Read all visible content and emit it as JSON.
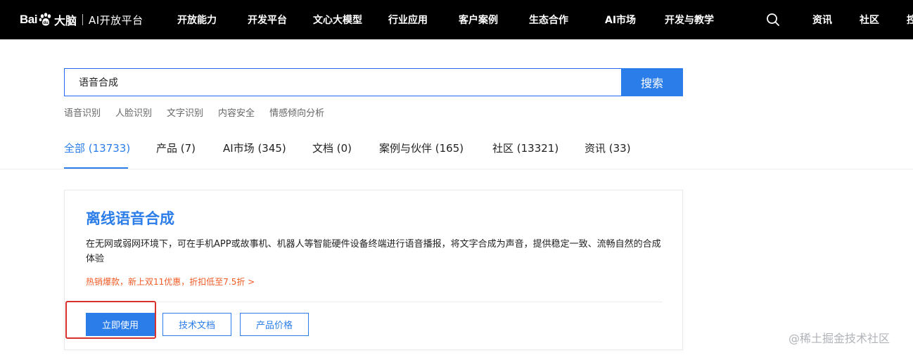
{
  "topnav": {
    "logo": {
      "bai": "Bai",
      "du": "大脑",
      "sub": "AI开放平台"
    },
    "items": [
      {
        "label": "开放能力"
      },
      {
        "label": "开发平台"
      },
      {
        "label": "文心大模型"
      },
      {
        "label": "行业应用"
      },
      {
        "label": "客户案例"
      },
      {
        "label": "生态合作"
      },
      {
        "label": "AI市场"
      },
      {
        "label": "开发与教学"
      }
    ],
    "search_icon": "search-icon",
    "right_items": [
      {
        "label": "资讯"
      },
      {
        "label": "社区"
      },
      {
        "label": "控"
      }
    ]
  },
  "search": {
    "value": "语音合成",
    "button_label": "搜索",
    "hot_keywords": [
      "语音识别",
      "人脸识别",
      "文字识别",
      "内容安全",
      "情感倾向分析"
    ]
  },
  "tabs": [
    {
      "label": "全部 (13733)",
      "active": true
    },
    {
      "label": "产品 (7)"
    },
    {
      "label": "AI市场 (345)"
    },
    {
      "label": "文档 (0)"
    },
    {
      "label": "案例与伙伴 (165)"
    },
    {
      "label": "社区 (13321)"
    },
    {
      "label": "资讯 (33)"
    }
  ],
  "result": {
    "title": "离线语音合成",
    "description": "在无网或弱网环境下，可在手机APP或故事机、机器人等智能硬件设备终端进行语音播报，将文字合成为声音，提供稳定一致、流畅自然的合成体验",
    "promo": "热销爆款，新上双11优惠，折扣低至7.5折 >",
    "buttons": {
      "use": "立即使用",
      "doc": "技术文档",
      "price": "产品价格"
    }
  },
  "watermark": "@稀土掘金技术社区",
  "colors": {
    "accent": "#2b7de9",
    "promo": "#f05a24",
    "highlight": "#d9302c",
    "nav_bg": "#000000"
  }
}
